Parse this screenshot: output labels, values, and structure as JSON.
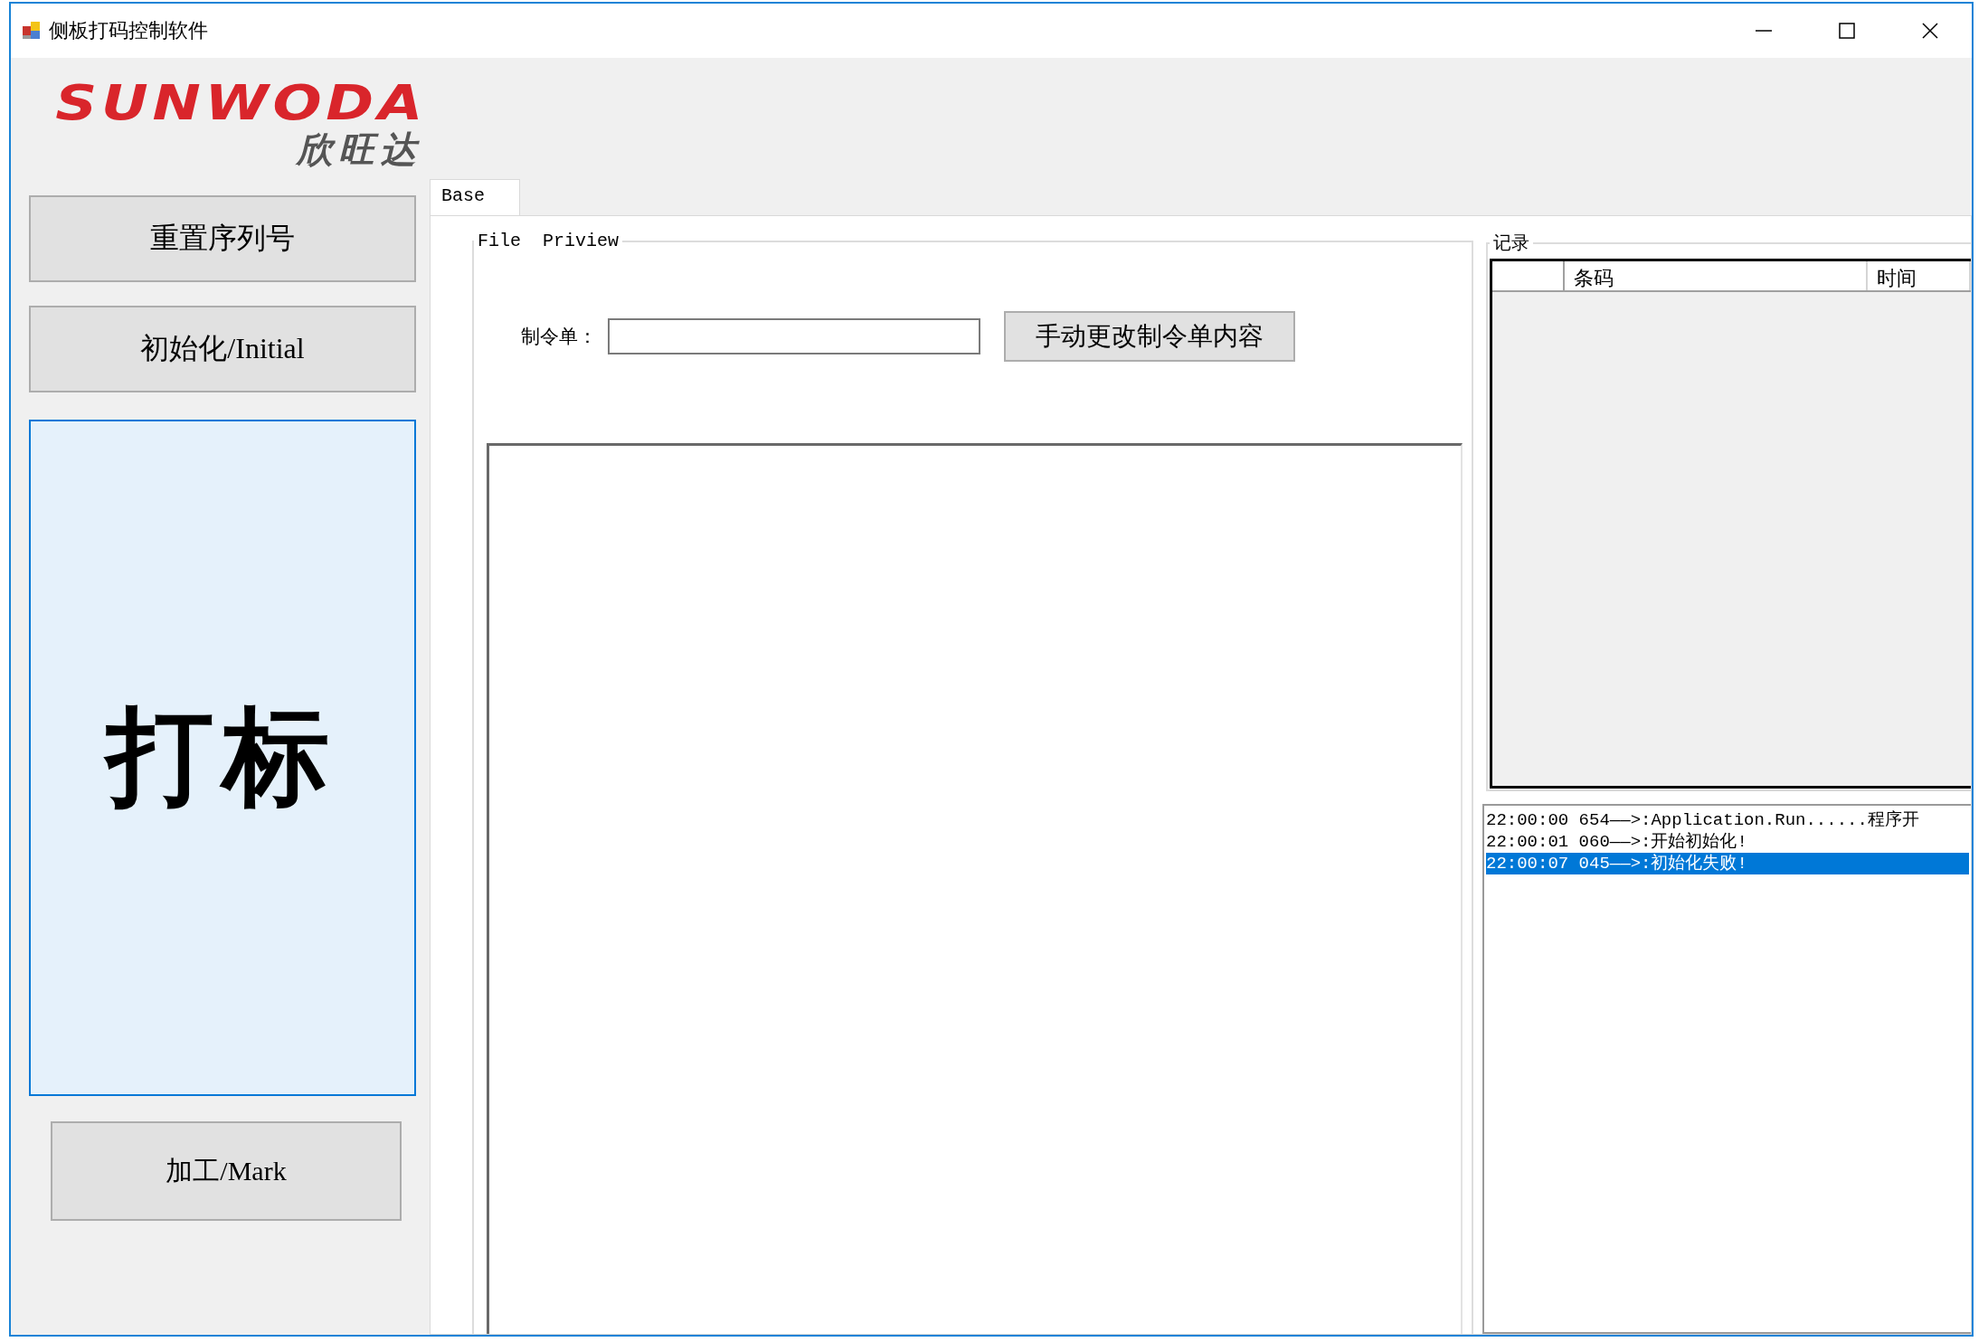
{
  "window": {
    "title": "侧板打码控制软件"
  },
  "logo": {
    "name": "SUNWODA",
    "subtitle": "欣旺达"
  },
  "side_buttons": [
    {
      "label": "重置序列号",
      "kind": "wide"
    },
    {
      "label": "初始化/Initial",
      "kind": "wide"
    },
    {
      "label": "打标",
      "kind": "big"
    },
    {
      "label": "加工/Mark",
      "kind": "narrow"
    }
  ],
  "tabs": [
    {
      "label": "Base",
      "selected": true
    }
  ],
  "file_group": {
    "title": "File  Priview",
    "order_label": "制令单：",
    "edit_button": "手动更改制令单内容"
  },
  "record_group": {
    "title": "记录",
    "columns": [
      "条码",
      "时间"
    ]
  },
  "log": [
    {
      "text": "22:00:00 654——>:Application.Run......程序开",
      "selected": false
    },
    {
      "text": "22:00:01 060——>:开始初始化!",
      "selected": false
    },
    {
      "text": "22:00:07 045——>:初始化失败!",
      "selected": true
    }
  ]
}
